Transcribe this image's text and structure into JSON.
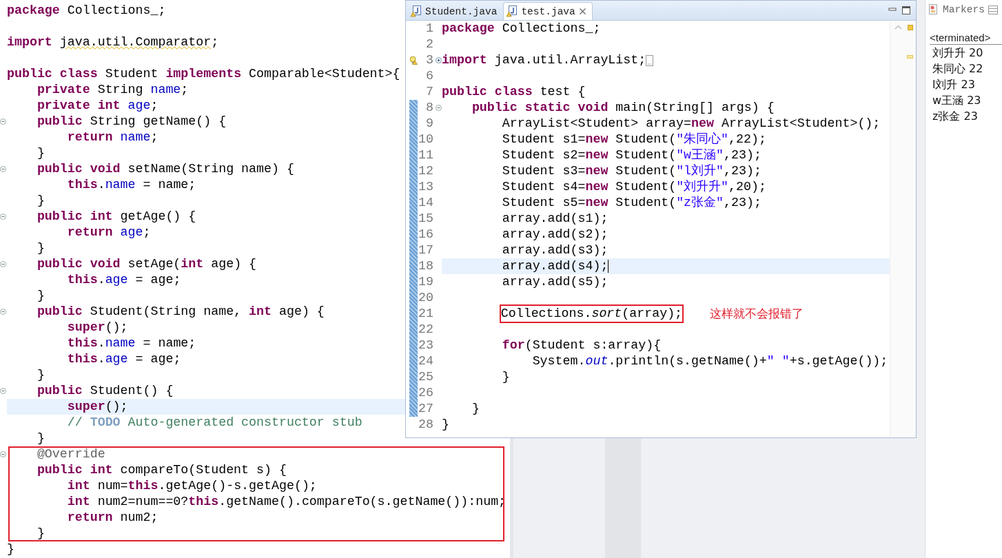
{
  "student_editor": {
    "lines": [
      {
        "current": false,
        "tokens": [
          {
            "kind": "kw",
            "text": "package"
          },
          {
            "kind": "plain",
            "text": " Collections_;"
          }
        ]
      },
      {
        "current": false
      },
      {
        "current": false,
        "tokens": [
          {
            "kind": "kw",
            "text": "import "
          },
          {
            "kind": "squiggle",
            "text": "java.util.Comparator"
          },
          {
            "kind": "plain",
            "text": ";"
          }
        ]
      },
      {
        "current": false
      },
      {
        "current": false,
        "tokens": [
          {
            "kind": "kw",
            "text": "public class "
          },
          {
            "kind": "plain",
            "text": "Student "
          },
          {
            "kind": "kw",
            "text": "implements"
          },
          {
            "kind": "plain",
            "text": " Comparable<Student>{"
          }
        ]
      },
      {
        "current": false,
        "tokens": [
          {
            "kind": "kw",
            "text": "    private"
          },
          {
            "kind": "plain",
            "text": " String "
          },
          {
            "kind": "field",
            "text": "name"
          },
          {
            "kind": "plain",
            "text": ";"
          }
        ]
      },
      {
        "current": false,
        "tokens": [
          {
            "kind": "kw",
            "text": "    private int "
          },
          {
            "kind": "field",
            "text": "age"
          },
          {
            "kind": "plain",
            "text": ";"
          }
        ]
      },
      {
        "current": false,
        "foldable": true,
        "tokens": [
          {
            "kind": "kw",
            "text": "    public"
          },
          {
            "kind": "plain",
            "text": " String getName() {"
          }
        ]
      },
      {
        "current": false,
        "tokens": [
          {
            "kind": "kw",
            "text": "        return "
          },
          {
            "kind": "field",
            "text": "name"
          },
          {
            "kind": "plain",
            "text": ";"
          }
        ]
      },
      {
        "current": false,
        "tokens": [
          {
            "kind": "plain",
            "text": "    }"
          }
        ]
      },
      {
        "current": false,
        "foldable": true,
        "tokens": [
          {
            "kind": "kw",
            "text": "    public void"
          },
          {
            "kind": "plain",
            "text": " setName(String name) {"
          }
        ]
      },
      {
        "current": false,
        "tokens": [
          {
            "kind": "kw",
            "text": "        this"
          },
          {
            "kind": "plain",
            "text": "."
          },
          {
            "kind": "field",
            "text": "name"
          },
          {
            "kind": "plain",
            "text": " = name;"
          }
        ]
      },
      {
        "current": false,
        "tokens": [
          {
            "kind": "plain",
            "text": "    }"
          }
        ]
      },
      {
        "current": false,
        "foldable": true,
        "tokens": [
          {
            "kind": "kw",
            "text": "    public int"
          },
          {
            "kind": "plain",
            "text": " getAge() {"
          }
        ]
      },
      {
        "current": false,
        "tokens": [
          {
            "kind": "kw",
            "text": "        return "
          },
          {
            "kind": "field",
            "text": "age"
          },
          {
            "kind": "plain",
            "text": ";"
          }
        ]
      },
      {
        "current": false,
        "tokens": [
          {
            "kind": "plain",
            "text": "    }"
          }
        ]
      },
      {
        "current": false,
        "foldable": true,
        "tokens": [
          {
            "kind": "kw",
            "text": "    public void"
          },
          {
            "kind": "plain",
            "text": " setAge("
          },
          {
            "kind": "kw",
            "text": "int"
          },
          {
            "kind": "plain",
            "text": " age) {"
          }
        ]
      },
      {
        "current": false,
        "tokens": [
          {
            "kind": "kw",
            "text": "        this"
          },
          {
            "kind": "plain",
            "text": "."
          },
          {
            "kind": "field",
            "text": "age"
          },
          {
            "kind": "plain",
            "text": " = age;"
          }
        ]
      },
      {
        "current": false,
        "tokens": [
          {
            "kind": "plain",
            "text": "    }"
          }
        ]
      },
      {
        "current": false,
        "foldable": true,
        "tokens": [
          {
            "kind": "kw",
            "text": "    public"
          },
          {
            "kind": "plain",
            "text": " Student(String name, "
          },
          {
            "kind": "kw",
            "text": "int"
          },
          {
            "kind": "plain",
            "text": " age) {"
          }
        ]
      },
      {
        "current": false,
        "tokens": [
          {
            "kind": "kw",
            "text": "        super"
          },
          {
            "kind": "plain",
            "text": "();"
          }
        ]
      },
      {
        "current": false,
        "tokens": [
          {
            "kind": "kw",
            "text": "        this"
          },
          {
            "kind": "plain",
            "text": "."
          },
          {
            "kind": "field",
            "text": "name"
          },
          {
            "kind": "plain",
            "text": " = name;"
          }
        ]
      },
      {
        "current": false,
        "tokens": [
          {
            "kind": "kw",
            "text": "        this"
          },
          {
            "kind": "plain",
            "text": "."
          },
          {
            "kind": "field",
            "text": "age"
          },
          {
            "kind": "plain",
            "text": " = age;"
          }
        ]
      },
      {
        "current": false,
        "tokens": [
          {
            "kind": "plain",
            "text": "    }"
          }
        ]
      },
      {
        "current": false,
        "foldable": true,
        "tokens": [
          {
            "kind": "kw",
            "text": "    public"
          },
          {
            "kind": "plain",
            "text": " Student() {"
          }
        ]
      },
      {
        "current": true,
        "tokens": [
          {
            "kind": "kw",
            "text": "        super"
          },
          {
            "kind": "plain",
            "text": "();"
          }
        ]
      },
      {
        "current": false,
        "tokens": [
          {
            "kind": "comment",
            "text": "        // "
          },
          {
            "kind": "todo",
            "text": "TODO"
          },
          {
            "kind": "comment",
            "text": " Auto-generated constructor stub"
          }
        ]
      },
      {
        "current": false,
        "tokens": [
          {
            "kind": "plain",
            "text": "    }"
          }
        ]
      }
    ],
    "highlight_box": {
      "lines": [
        {
          "foldable": true,
          "tokens": [
            {
              "kind": "annot",
              "text": "    @Override"
            }
          ]
        },
        {
          "tokens": [
            {
              "kind": "kw",
              "text": "    public int"
            },
            {
              "kind": "plain",
              "text": " compareTo(Student s) {"
            }
          ]
        },
        {
          "tokens": [
            {
              "kind": "kw",
              "text": "        int"
            },
            {
              "kind": "plain",
              "text": " num="
            },
            {
              "kind": "kw",
              "text": "this"
            },
            {
              "kind": "plain",
              "text": ".getAge()-s.getAge();"
            }
          ]
        },
        {
          "tokens": [
            {
              "kind": "kw",
              "text": "        int"
            },
            {
              "kind": "plain",
              "text": " num2=num==0?"
            },
            {
              "kind": "kw",
              "text": "this"
            },
            {
              "kind": "plain",
              "text": ".getName().compareTo(s.getName()):num;"
            }
          ]
        },
        {
          "tokens": [
            {
              "kind": "kw",
              "text": "        return"
            },
            {
              "kind": "plain",
              "text": " num2;"
            }
          ]
        },
        {
          "tokens": [
            {
              "kind": "plain",
              "text": "    }"
            }
          ]
        }
      ]
    },
    "closing_lines": [
      {
        "current": false,
        "tokens": [
          {
            "kind": "plain",
            "text": "}"
          }
        ]
      }
    ]
  },
  "editor_window": {
    "tabs": [
      {
        "label": "Student.java",
        "selected": false,
        "closable": false
      },
      {
        "label": "test.java",
        "selected": true,
        "closable": true
      }
    ],
    "lines": [
      {
        "number": "1",
        "changed": false,
        "tokens": [
          {
            "kind": "kw",
            "text": "package"
          },
          {
            "kind": "plain",
            "text": " Collections_;"
          }
        ]
      },
      {
        "number": "2",
        "changed": false
      },
      {
        "number": "3",
        "changed": false,
        "foldable": true,
        "warning": true,
        "collapsed": true,
        "tokens": [
          {
            "kind": "kw",
            "text": "import"
          },
          {
            "kind": "plain",
            "text": " java.util.ArrayList;"
          }
        ]
      },
      {
        "number": "6",
        "changed": false
      },
      {
        "number": "7",
        "changed": false,
        "tokens": [
          {
            "kind": "kw",
            "text": "public class"
          },
          {
            "kind": "plain",
            "text": " test {"
          }
        ]
      },
      {
        "number": "8",
        "changed": true,
        "foldable": true,
        "tokens": [
          {
            "kind": "kw",
            "text": "    public static void"
          },
          {
            "kind": "plain",
            "text": " main(String[] args) {"
          }
        ]
      },
      {
        "number": "9",
        "changed": true,
        "tokens": [
          {
            "kind": "plain",
            "text": "        ArrayList<Student> array="
          },
          {
            "kind": "kw",
            "text": "new"
          },
          {
            "kind": "plain",
            "text": " ArrayList<Student>();"
          }
        ]
      },
      {
        "number": "10",
        "changed": true,
        "tokens": [
          {
            "kind": "plain",
            "text": "        Student s1="
          },
          {
            "kind": "kw",
            "text": "new"
          },
          {
            "kind": "plain",
            "text": " Student("
          },
          {
            "kind": "string",
            "text": "\"朱同心\""
          },
          {
            "kind": "plain",
            "text": ",22);"
          }
        ]
      },
      {
        "number": "11",
        "changed": true,
        "tokens": [
          {
            "kind": "plain",
            "text": "        Student s2="
          },
          {
            "kind": "kw",
            "text": "new"
          },
          {
            "kind": "plain",
            "text": " Student("
          },
          {
            "kind": "string",
            "text": "\"w王涵\""
          },
          {
            "kind": "plain",
            "text": ",23);"
          }
        ]
      },
      {
        "number": "12",
        "changed": true,
        "tokens": [
          {
            "kind": "plain",
            "text": "        Student s3="
          },
          {
            "kind": "kw",
            "text": "new"
          },
          {
            "kind": "plain",
            "text": " Student("
          },
          {
            "kind": "string",
            "text": "\"l刘升\""
          },
          {
            "kind": "plain",
            "text": ",23);"
          }
        ]
      },
      {
        "number": "13",
        "changed": true,
        "tokens": [
          {
            "kind": "plain",
            "text": "        Student s4="
          },
          {
            "kind": "kw",
            "text": "new"
          },
          {
            "kind": "plain",
            "text": " Student("
          },
          {
            "kind": "string",
            "text": "\"刘升升\""
          },
          {
            "kind": "plain",
            "text": ",20);"
          }
        ]
      },
      {
        "number": "14",
        "changed": true,
        "tokens": [
          {
            "kind": "plain",
            "text": "        Student s5="
          },
          {
            "kind": "kw",
            "text": "new"
          },
          {
            "kind": "plain",
            "text": " Student("
          },
          {
            "kind": "string",
            "text": "\"z张金\""
          },
          {
            "kind": "plain",
            "text": ",23);"
          }
        ]
      },
      {
        "number": "15",
        "changed": true,
        "tokens": [
          {
            "kind": "plain",
            "text": "        array.add(s1);"
          }
        ]
      },
      {
        "number": "16",
        "changed": true,
        "tokens": [
          {
            "kind": "plain",
            "text": "        array.add(s2);"
          }
        ]
      },
      {
        "number": "17",
        "changed": true,
        "tokens": [
          {
            "kind": "plain",
            "text": "        array.add(s3);"
          }
        ]
      },
      {
        "number": "18",
        "changed": true,
        "current": true,
        "tokens": [
          {
            "kind": "plain",
            "text": "        array.add(s4);"
          }
        ]
      },
      {
        "number": "19",
        "changed": true,
        "tokens": [
          {
            "kind": "plain",
            "text": "        array.add(s5);"
          }
        ]
      },
      {
        "number": "20",
        "changed": true
      },
      {
        "number": "21",
        "changed": true,
        "boxed": true,
        "note": "这样就不会报错了",
        "tokens": [
          {
            "kind": "plain",
            "text": "        Collections."
          },
          {
            "kind": "italic",
            "text": "sort"
          },
          {
            "kind": "plain",
            "text": "(array);"
          }
        ]
      },
      {
        "number": "22",
        "changed": true
      },
      {
        "number": "23",
        "changed": true,
        "tokens": [
          {
            "kind": "kw",
            "text": "        for"
          },
          {
            "kind": "plain",
            "text": "(Student s:array){"
          }
        ]
      },
      {
        "number": "24",
        "changed": true,
        "tokens": [
          {
            "kind": "plain",
            "text": "            System."
          },
          {
            "kind": "static",
            "text": "out"
          },
          {
            "kind": "plain",
            "text": ".println(s.getName()+"
          },
          {
            "kind": "string",
            "text": "\" \""
          },
          {
            "kind": "plain",
            "text": "+s.getAge());"
          }
        ]
      },
      {
        "number": "25",
        "changed": true,
        "tokens": [
          {
            "kind": "plain",
            "text": "        }"
          }
        ]
      },
      {
        "number": "26",
        "changed": true
      },
      {
        "number": "27",
        "changed": true,
        "tokens": [
          {
            "kind": "plain",
            "text": "    }"
          }
        ]
      },
      {
        "number": "28",
        "changed": false,
        "tokens": [
          {
            "kind": "plain",
            "text": "}"
          }
        ]
      }
    ]
  },
  "side_panel": {
    "tab": "Markers",
    "console_header": "<terminated>",
    "console_lines": [
      "刘升升 20",
      "朱同心 22",
      "l刘升 23",
      "w王涵 23",
      "z张金 23"
    ]
  }
}
